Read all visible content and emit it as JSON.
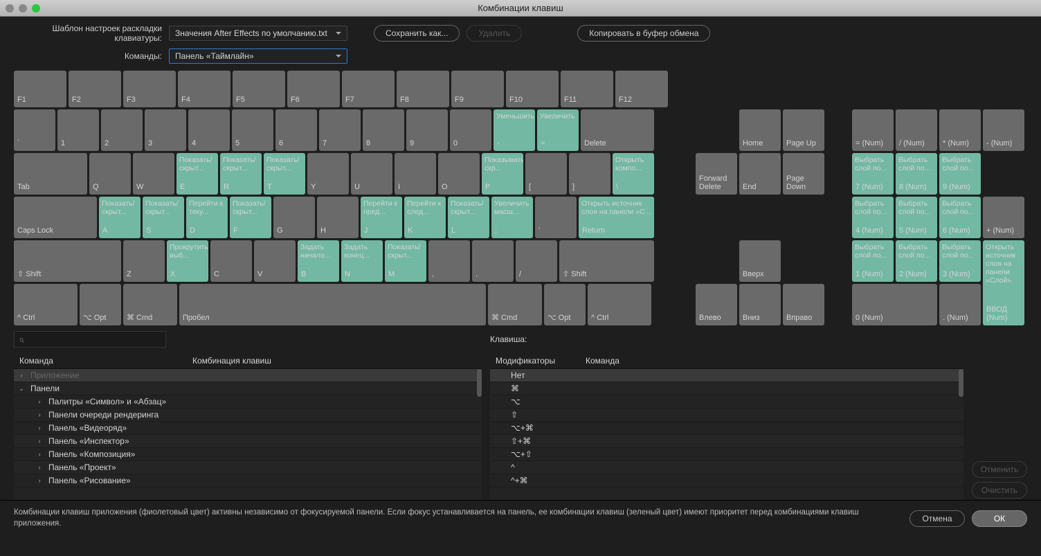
{
  "title": "Комбинации клавиш",
  "toolbar": {
    "layoutLabel": "Шаблон настроек раскладки клавиатуры:",
    "layoutValue": "Значения After Effects по умолчанию.txt",
    "saveAs": "Сохранить как...",
    "delete": "Удалить",
    "copy": "Копировать в буфер обмена",
    "cmdLabel": "Команды:",
    "cmdValue": "Панель «Таймлайн»"
  },
  "keys": {
    "f1": "F1",
    "f2": "F2",
    "f3": "F3",
    "f4": "F4",
    "f5": "F5",
    "f6": "F6",
    "f7": "F7",
    "f8": "F8",
    "f9": "F9",
    "f10": "F10",
    "f11": "F11",
    "f12": "F12",
    "tick": "`",
    "k1": "1",
    "k2": "2",
    "k3": "3",
    "k4": "4",
    "k5": "5",
    "k6": "6",
    "k7": "7",
    "k8": "8",
    "k9": "9",
    "k0": "0",
    "minus": "-",
    "minusCmd": "Уменьшить",
    "equal": "=",
    "equalCmd": "Увеличить",
    "delete": "Delete",
    "tab": "Tab",
    "q": "Q",
    "w": "W",
    "e": "E",
    "eCmd": "Показать/скрыт...",
    "r": "R",
    "rCmd": "Показать/скрыт...",
    "t": "T",
    "tCmd": "Показать/скрыт...",
    "y": "Y",
    "u": "U",
    "i": "I",
    "o": "O",
    "p": "P",
    "pCmd": "Показывать/скр...",
    "lb": "[",
    "rb": "]",
    "bslash": "\\",
    "bslashCmd": "Открыть компо...",
    "caps": "Caps Lock",
    "a": "A",
    "aCmd": "Показать/скрыт...",
    "s": "S",
    "sCmd": "Показать/скрыт...",
    "d": "D",
    "dCmd": "Перейти к теку...",
    "f": "F",
    "fCmd": "Показать/скрыт...",
    "g": "G",
    "h": "H",
    "j": "J",
    "jCmd": "Перейти к пред...",
    "k": "K",
    "kCmd": "Перейти к след...",
    "l": "L",
    "lCmd": "Показать/скрыт...",
    "semi": ";",
    "semiCmd": "Увеличить масш...",
    "quote": "'",
    "return": "Return",
    "returnCmd": "Открыть источник слоя на панели «С...",
    "lshift": "⇧ Shift",
    "z": "Z",
    "x": "X",
    "xCmd": "Прокрутить выб...",
    "c": "C",
    "v": "V",
    "b": "B",
    "bCmd": "Задать начало...",
    "n": "N",
    "nCmd": "Задать конец...",
    "m": "M",
    "mCmd": "Показать/скрыт...",
    "comma": ",",
    "dot": ".",
    "slash": "/",
    "rshift": "⇧ Shift",
    "lctrl": "^ Ctrl",
    "lopt": "⌥ Opt",
    "lcmd": "⌘ Cmd",
    "space": "Пробел",
    "rcmd": "⌘ Cmd",
    "ropt": "⌥ Opt",
    "rctrl": "^ Ctrl",
    "home": "Home",
    "pgup": "Page Up",
    "fdel": "Forward Delete",
    "end": "End",
    "pgdn": "Page Down",
    "up": "Вверх",
    "left": "Влево",
    "down": "Вниз",
    "right": "Вправо",
    "neq": "= (Num)",
    "ndiv": "/ (Num)",
    "nmul": "* (Num)",
    "nsub": "- (Num)",
    "n7": "7 (Num)",
    "n7Cmd": "Выбрать слой по...",
    "n8": "8 (Num)",
    "n8Cmd": "Выбрать слой по...",
    "n9": "9 (Num)",
    "n9Cmd": "Выбрать слой по...",
    "n4": "4 (Num)",
    "n4Cmd": "Выбрать слой по...",
    "n5": "5 (Num)",
    "n5Cmd": "Выбрать слой по...",
    "n6": "6 (Num)",
    "n6Cmd": "Выбрать слой по...",
    "nadd": "+ (Num)",
    "n1": "1 (Num)",
    "n1Cmd": "Выбрать слой по...",
    "n2": "2 (Num)",
    "n2Cmd": "Выбрать слой по...",
    "n3": "3 (Num)",
    "n3Cmd": "Выбрать слой по...",
    "n0": "0 (Num)",
    "ndec": ". (Num)",
    "nent": "ВВОД (Num)",
    "nentCmd": "Открыть источник слоя на панели «Слой»"
  },
  "leftPanel": {
    "cmdHdr": "Команда",
    "shortHdr": "Комбинация клавиш",
    "rows": [
      {
        "arrow": "›",
        "label": "Приложение",
        "indent": 0,
        "sel": true,
        "dim": true
      },
      {
        "arrow": "⌄",
        "label": "Панели",
        "indent": 0
      },
      {
        "arrow": "›",
        "label": "Палитры «Символ» и «Абзац»",
        "indent": 1
      },
      {
        "arrow": "›",
        "label": "Панели очереди рендеринга",
        "indent": 1
      },
      {
        "arrow": "›",
        "label": "Панель «Видеоряд»",
        "indent": 1
      },
      {
        "arrow": "›",
        "label": "Панель «Инспектор»",
        "indent": 1
      },
      {
        "arrow": "›",
        "label": "Панель «Композиция»",
        "indent": 1
      },
      {
        "arrow": "›",
        "label": "Панель «Проект»",
        "indent": 1
      },
      {
        "arrow": "›",
        "label": "Панель «Рисование»",
        "indent": 1
      }
    ]
  },
  "rightPanel": {
    "keyLabel": "Клавиша:",
    "modHdr": "Модификаторы",
    "cmdHdr": "Команда",
    "rows": [
      "Нет",
      "⌘",
      "⌥",
      "⇧",
      "⌥+⌘",
      "⇧+⌘",
      "⌥+⇧",
      "^",
      "^+⌘"
    ],
    "undo": "Отменить",
    "clear": "Очистить"
  },
  "footer": {
    "help": "Комбинации клавиш приложения (фиолетовый цвет) активны независимо от фокусируемой панели. Если фокус устанавливается на панель, ее комбинации клавиш (зеленый цвет) имеют приоритет перед комбинациями клавиш приложения.",
    "cancel": "Отмена",
    "ok": "ОК"
  }
}
